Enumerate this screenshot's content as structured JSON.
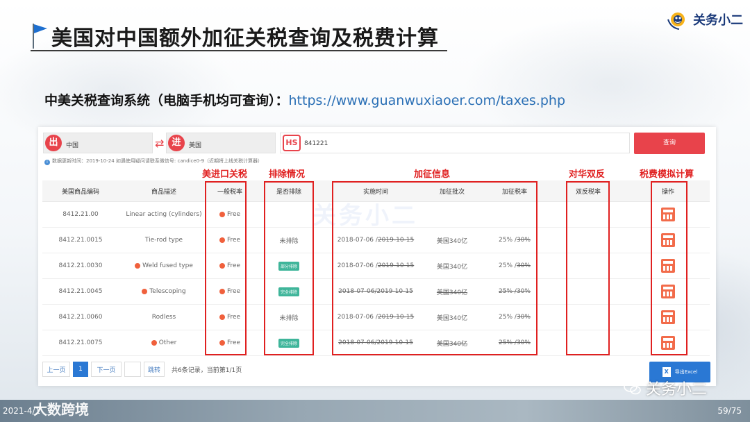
{
  "slide": {
    "title": "美国对中国额外加征关税查询及税费计算",
    "subtitle_label": "中美关税查询系统（电脑手机均可查询）：",
    "subtitle_url": "https://www.guanwuxiaoer.com/taxes.php",
    "brand_name": "关务小二",
    "footer_date": "2021-4/1",
    "footer_brand": "大数跨境",
    "page_number": "59/75",
    "wechat_name": "关务小二"
  },
  "search": {
    "origin_badge": "出",
    "origin_value": "中国",
    "swap_symbol": "⇄",
    "dest_badge": "进",
    "dest_value": "美国",
    "hs_badge": "HS",
    "hs_value": "841221",
    "query_label": "查询",
    "notice": "数据更新时间：2019-10-24    如遇使用疑问请联系微信号: candice0-9（近期将上线关税计算器）"
  },
  "watermark": "关务小二",
  "annotations": {
    "general_rate": "美进口关税",
    "exclusion": "排除情况",
    "additional": "加征信息",
    "anti_dumping": "对华双反",
    "calculator": "税费模拟计算"
  },
  "table": {
    "headers": {
      "code": "美国商品编码",
      "desc": "商品描述",
      "general_rate": "一般税率",
      "excluded": "是否排除",
      "effective_date": "实施时间",
      "batch": "加征批次",
      "add_rate": "加征税率",
      "ad_cvd": "双反税率",
      "action": "操作"
    },
    "rows": [
      {
        "code": "8412.21.00",
        "desc": "Linear acting (cylinders)",
        "desc_dot": false,
        "rate": "Free",
        "excluded": "",
        "excluded_type": "none",
        "date_start": "",
        "date_end": "",
        "batch": "",
        "add_rate": "",
        "add_rate_old": "",
        "struck": false
      },
      {
        "code": "8412.21.0015",
        "desc": "Tie-rod type",
        "desc_dot": false,
        "rate": "Free",
        "excluded": "未排除",
        "excluded_type": "text",
        "date_start": "2018-07-06 / ",
        "date_end": "2019-10-15",
        "batch": "美国340亿",
        "add_rate": "25% / ",
        "add_rate_old": "30%",
        "struck": false
      },
      {
        "code": "8412.21.0030",
        "desc": "Weld fused type",
        "desc_dot": true,
        "rate": "Free",
        "excluded": "部分排除",
        "excluded_type": "tag",
        "date_start": "2018-07-06 / ",
        "date_end": "2019-10-15",
        "batch": "美国340亿",
        "add_rate": "25% / ",
        "add_rate_old": "30%",
        "struck": false
      },
      {
        "code": "8412.21.0045",
        "desc": "Telescoping",
        "desc_dot": true,
        "rate": "Free",
        "excluded": "完全排除",
        "excluded_type": "tag",
        "date_start": "2018-07-06/",
        "date_end": "2019-10-15",
        "batch": "美国340亿",
        "add_rate": "25% / ",
        "add_rate_old": "30%",
        "struck": true
      },
      {
        "code": "8412.21.0060",
        "desc": "Rodless",
        "desc_dot": false,
        "rate": "Free",
        "excluded": "未排除",
        "excluded_type": "text",
        "date_start": "2018-07-06 / ",
        "date_end": "2019-10-15",
        "batch": "美国340亿",
        "add_rate": "25% / ",
        "add_rate_old": "30%",
        "struck": false
      },
      {
        "code": "8412.21.0075",
        "desc": "Other",
        "desc_dot": true,
        "rate": "Free",
        "excluded": "完全排除",
        "excluded_type": "tag",
        "date_start": "2018-07-06/",
        "date_end": "2019-10-15",
        "batch": "美国340亿",
        "add_rate": "25% / ",
        "add_rate_old": "30%",
        "struck": true
      }
    ]
  },
  "pager": {
    "prev": "上一页",
    "current": "1",
    "next": "下一页",
    "jump_value": "",
    "jump": "跳转",
    "info": "共6条记录，当前第1/1页",
    "export": "导出Excel",
    "export_icon": "X"
  },
  "colors": {
    "accent_red": "#e8434b",
    "frame_red": "#e02020",
    "tag_green": "#3fb59a",
    "primary_blue": "#2a78d4"
  }
}
